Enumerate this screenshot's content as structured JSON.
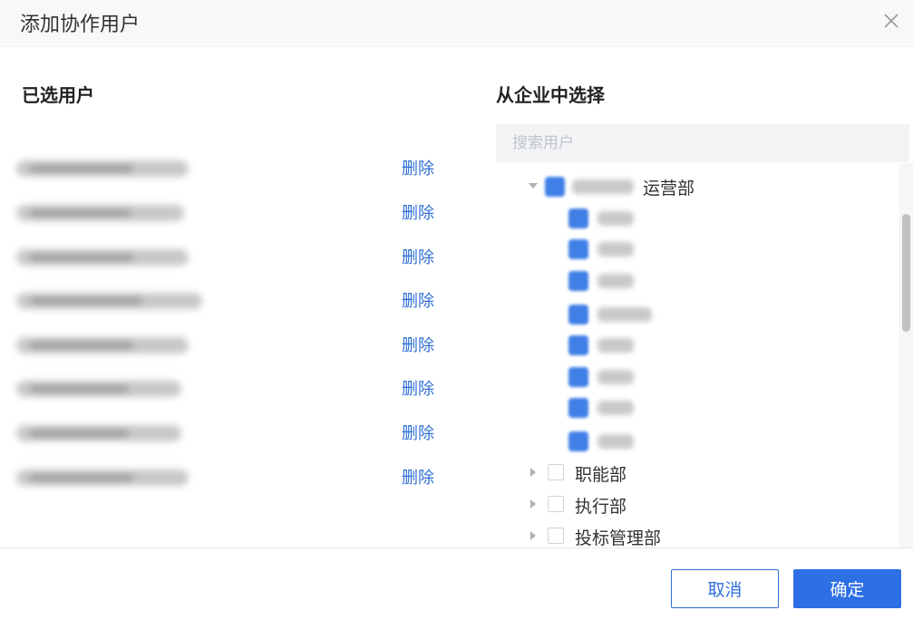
{
  "dialog": {
    "title": "添加协作用户"
  },
  "selected": {
    "title": "已选用户",
    "delete_label": "删除",
    "count_rows": 8
  },
  "org": {
    "title": "从企业中选择",
    "search_placeholder": "搜索用户",
    "root_dept_suffix": "运营部",
    "departments": [
      "职能部",
      "执行部",
      "投标管理部"
    ]
  },
  "footer": {
    "cancel_label": "取消",
    "ok_label": "确定"
  },
  "colors": {
    "accent": "#2d6fe5",
    "link": "#2f6fd6"
  },
  "icons": {
    "close": "close-icon",
    "caret_down": "caret-down-icon",
    "caret_right": "caret-right-icon"
  }
}
